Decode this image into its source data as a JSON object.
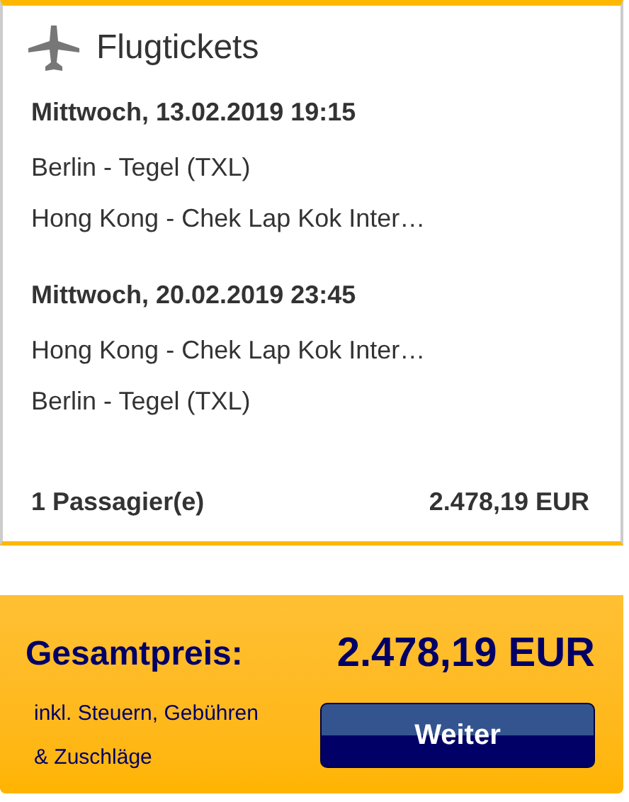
{
  "header": {
    "title": "Flugtickets"
  },
  "flights": [
    {
      "datetime": "Mittwoch, 13.02.2019 19:15",
      "from": "Berlin - Tegel (TXL)",
      "to": "Hong Kong - Chek Lap Kok Inter…"
    },
    {
      "datetime": "Mittwoch, 20.02.2019 23:45",
      "from": "Hong Kong - Chek Lap Kok Inter…",
      "to": "Berlin - Tegel (TXL)"
    }
  ],
  "passengers": {
    "label": "1 Passagier(e)",
    "price": "2.478,19 EUR"
  },
  "total": {
    "label": "Gesamtpreis:",
    "price": "2.478,19 EUR",
    "note_line_1": "inkl. Steuern, Gebühren",
    "note_line_2": "& Zuschläge",
    "button": "Weiter"
  }
}
